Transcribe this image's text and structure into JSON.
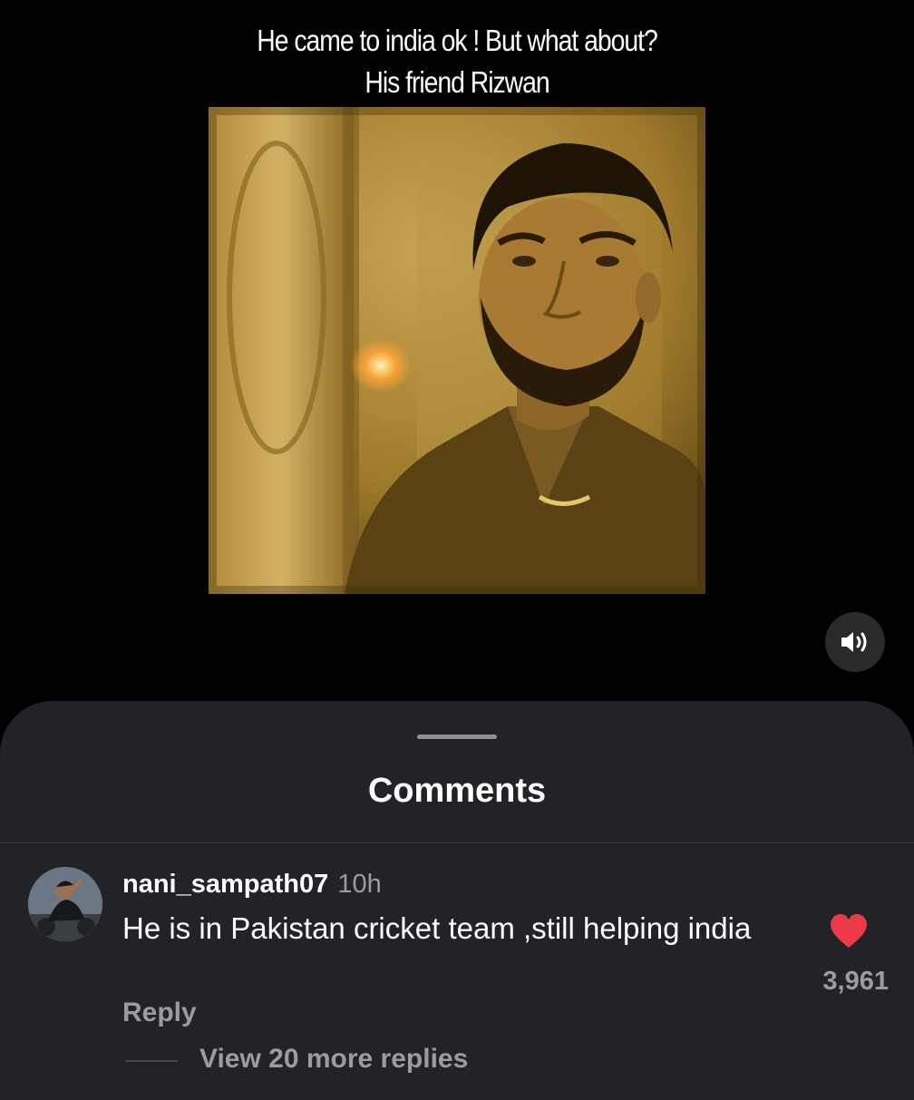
{
  "post": {
    "caption_line1": "He came to india ok ! But what about?",
    "caption_line2": "His friend Rizwan",
    "video_frame_icon": "sepia-man-video-frame",
    "sound_icon": "speaker-unmuted-icon"
  },
  "comments_sheet": {
    "title": "Comments",
    "comments": [
      {
        "username": "nani_sampath07",
        "time": "10h",
        "text": "He  is in Pakistan cricket team ,still helping india",
        "reply_label": "Reply",
        "likes": "3,961",
        "liked": true,
        "view_replies_label": "View 20 more replies"
      }
    ]
  },
  "colors": {
    "background": "#000000",
    "sheet": "#222326",
    "muted_text": "#9a9ca2",
    "like_red": "#ed3a4a"
  }
}
